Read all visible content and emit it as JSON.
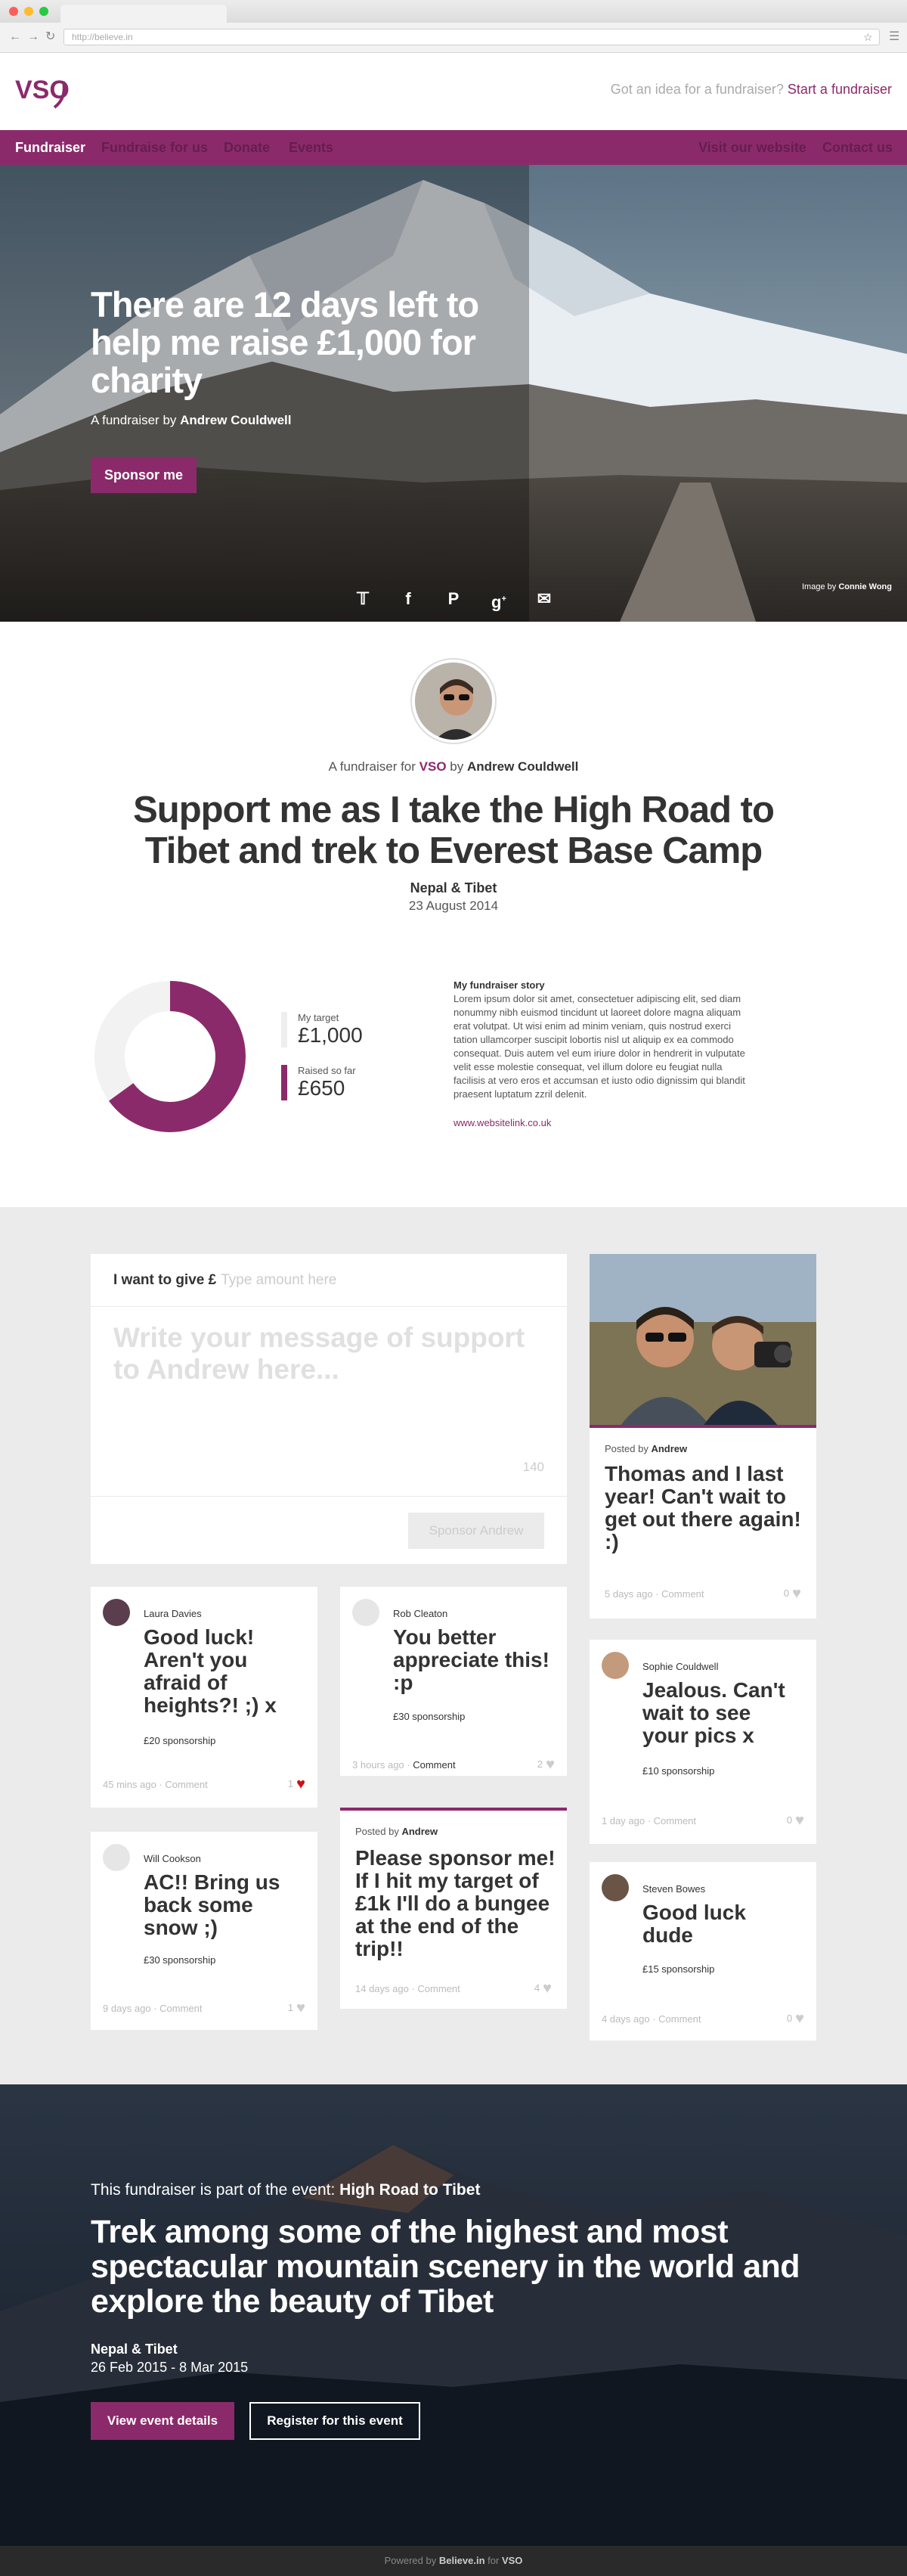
{
  "browser": {
    "url": "http://believe.in"
  },
  "header": {
    "logo_text": "VSO",
    "cta_question": "Got an idea for a fundraiser?",
    "cta_link": "Start a fundraiser"
  },
  "nav": {
    "left": [
      "Fundraiser",
      "Fundraise for us",
      "Donate",
      "Events"
    ],
    "right": [
      "Visit our website",
      "Contact us"
    ],
    "active_index": 0
  },
  "hero": {
    "title": "There are 12 days left to help me raise £1,000 for charity",
    "by_prefix": "A fundraiser by",
    "by_name": "Andrew Couldwell",
    "sponsor_button": "Sponsor me",
    "social_icons": [
      "twitter-icon",
      "facebook-icon",
      "pinterest-icon",
      "google-plus-icon",
      "email-icon"
    ],
    "credit_prefix": "Image by",
    "credit_name": "Connie Wong"
  },
  "profile": {
    "for_prefix": "A fundraiser for",
    "charity": "VSO",
    "by_word": "by",
    "name": "Andrew Couldwell",
    "title": "Support me as I take the High Road to Tibet and trek to Everest Base Camp",
    "location": "Nepal & Tibet",
    "date": "23 August 2014"
  },
  "progress": {
    "target_label": "My target",
    "target_value": "£1,000",
    "raised_label": "Raised so far",
    "raised_value": "£650",
    "fraction": 0.65
  },
  "story": {
    "heading": "My fundraiser story",
    "body": "Lorem ipsum dolor sit amet, consectetuer adipiscing elit, sed diam nonummy nibh euismod tincidunt ut laoreet dolore magna aliquam erat volutpat. Ut wisi enim ad minim veniam, quis nostrud exerci tation ullamcorper suscipit lobortis nisl ut aliquip ex ea commodo consequat. Duis autem vel eum iriure dolor in hendrerit in vulputate velit esse molestie consequat, vel illum dolore eu feugiat nulla facilisis at vero eros et accumsan et iusto odio dignissim qui blandit praesent luptatum zzril delenit.",
    "link": "www.websitelink.co.uk"
  },
  "donate": {
    "give_label": "I want to give £",
    "amount_placeholder": "Type amount here",
    "message_placeholder": "Write your message of support to Andrew here...",
    "char_count": "140",
    "submit": "Sponsor Andrew"
  },
  "feed": {
    "photo_post": {
      "posted_by_prefix": "Posted by",
      "author": "Andrew",
      "message": "Thomas and I last year! Can't wait to get out there again! :)",
      "time": "5 days ago",
      "comment": "Comment",
      "likes": "0"
    },
    "laura": {
      "name": "Laura Davies",
      "message": "Good luck! Aren't you afraid of heights?! ;) x",
      "amount": "£20 sponsorship",
      "time": "45 mins ago",
      "comment": "Comment",
      "likes": "1"
    },
    "rob": {
      "name": "Rob Cleaton",
      "message": "You better appreciate this! :p",
      "amount": "£30 sponsorship",
      "time": "3 hours ago",
      "comment": "Comment",
      "likes": "2"
    },
    "sophie": {
      "name": "Sophie Couldwell",
      "message": "Jealous. Can't wait to see your pics x",
      "amount": "£10 sponsorship",
      "time": "1 day ago",
      "comment": "Comment",
      "likes": "0"
    },
    "will": {
      "name": "Will Cookson",
      "message": "AC!! Bring us back some snow ;)",
      "amount": "£30 sponsorship",
      "time": "9 days ago",
      "comment": "Comment",
      "likes": "1"
    },
    "andrew_post": {
      "posted_by_prefix": "Posted by",
      "author": "Andrew",
      "message": "Please sponsor me! If I hit my target of £1k I'll do a bungee at the end of the trip!!",
      "time": "14 days ago",
      "comment": "Comment",
      "likes": "4"
    },
    "steven": {
      "name": "Steven Bowes",
      "message": "Good luck dude",
      "amount": "£15 sponsorship",
      "time": "4 days ago",
      "comment": "Comment",
      "likes": "0"
    }
  },
  "event": {
    "part_prefix": "This fundraiser is part of the event:",
    "event_name": "High Road to Tibet",
    "title": "Trek among some of the highest and most spectacular mountain scenery in the world and explore the beauty of Tibet",
    "location": "Nepal & Tibet",
    "dates": "26 Feb 2015 - 8 Mar 2015",
    "button_details": "View event details",
    "button_register": "Register for this event"
  },
  "footer": {
    "prefix": "Powered by",
    "brand": "Believe.in",
    "for_word": "for",
    "charity": "VSO"
  },
  "colors": {
    "brand": "#8b2a6b",
    "grey_bg": "#ebebeb"
  }
}
